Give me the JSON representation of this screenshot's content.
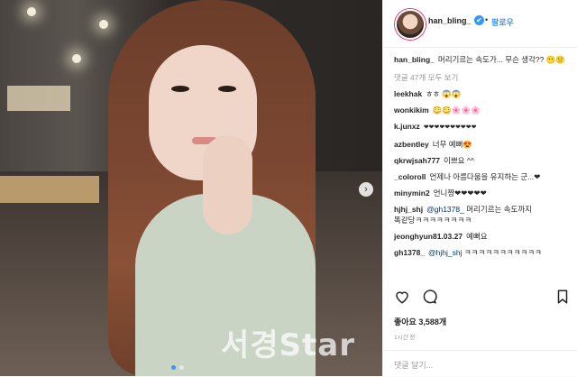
{
  "header": {
    "username": "han_bling_",
    "verified_mark": "✔",
    "separator": "•",
    "follow_label": "팔로우"
  },
  "caption": {
    "user": "han_bling_",
    "text": "머리기르는 속도가... 무슨 생각?? 😶🙂"
  },
  "view_all": "댓글 47개 모두 보기",
  "comments": [
    {
      "user": "leekhak",
      "text": "ㅎㅎ 😱😱"
    },
    {
      "user": "wonkikim",
      "text": "😳😳🌸🌸🌸"
    },
    {
      "user": "k.junxz",
      "text": "❤❤❤❤❤❤❤❤❤❤"
    },
    {
      "user": "azbentley",
      "text": "너무 예뻐😍"
    },
    {
      "user": "qkrwjsah777",
      "text": "이쁘요 ^^"
    },
    {
      "user": "_coloroll",
      "text": "언제나 아름다움을 유지하는 군...❤"
    },
    {
      "user": "minymin2",
      "text": "언니짱❤❤❤❤❤"
    },
    {
      "user": "hjhj_shj",
      "mention": "@gh1378_",
      "text": "머리기르는 속도까지 똑같당ㅋㅋㅋㅋㅋㅋㅋㅋ"
    },
    {
      "user": "jeonghyun81.03.27",
      "text": "예뻐요"
    },
    {
      "user": "gh1378_",
      "mention": "@hjhj_shj",
      "text": "ㅋㅋㅋㅋㅋㅋㅋㅋㅋㅋㅋ"
    }
  ],
  "likes": "좋아요 3,588개",
  "time_ago": "1시간 전",
  "add_comment_placeholder": "댓글 달기...",
  "watermark": "서경Star",
  "icons": {
    "like": "heart-icon",
    "comment": "comment-icon",
    "save": "bookmark-icon",
    "next": "chevron-right-icon"
  },
  "colors": {
    "link": "#3897f0",
    "text": "#262626",
    "muted": "#999999"
  }
}
